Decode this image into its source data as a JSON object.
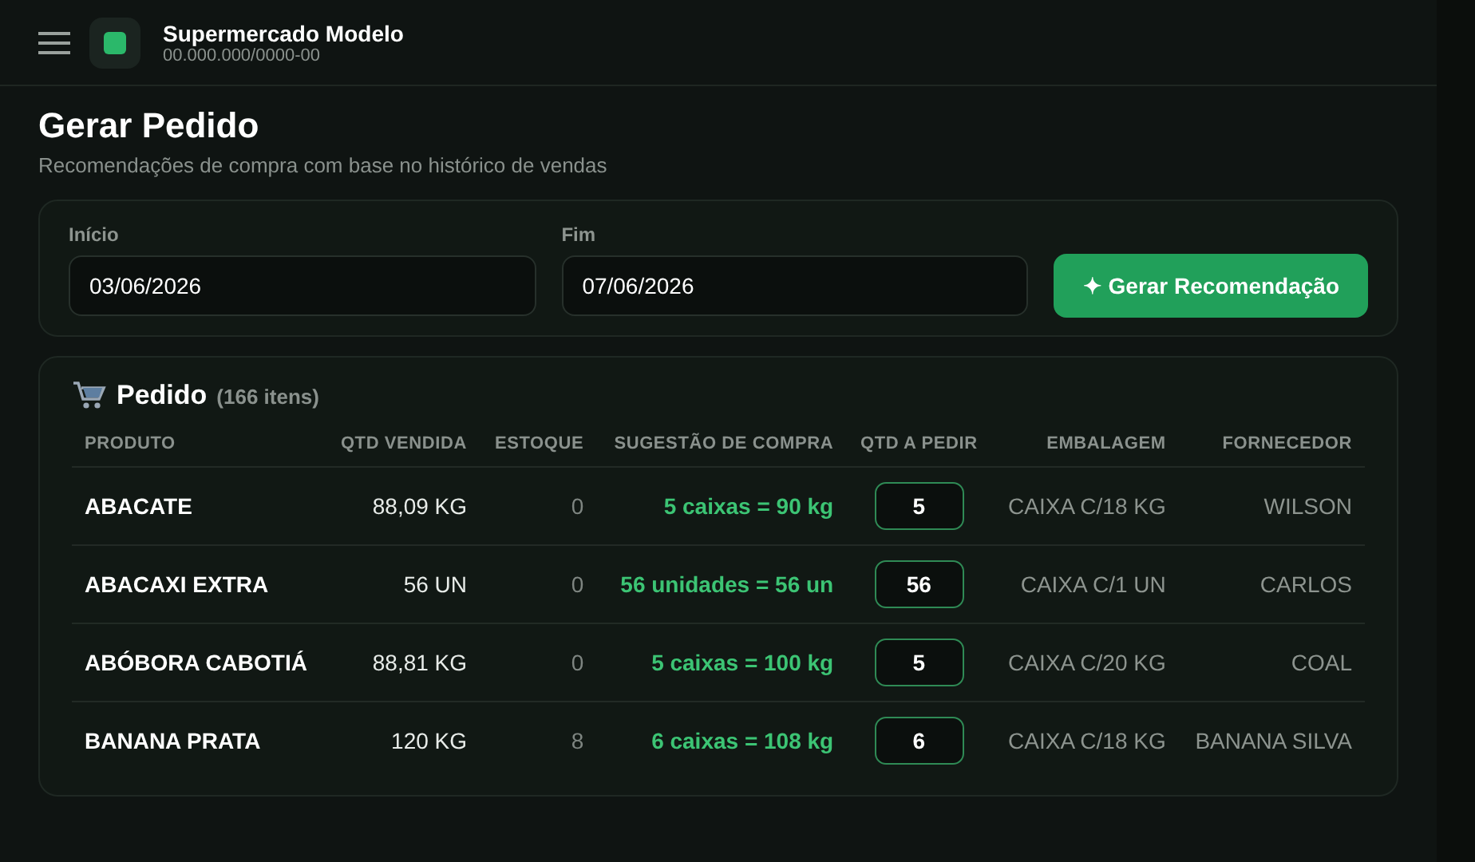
{
  "header": {
    "company": "Supermercado Modelo",
    "document": "00.000.000/0000-00"
  },
  "page": {
    "title": "Gerar Pedido",
    "subtitle": "Recomendações de compra com base no histórico de vendas"
  },
  "filters": {
    "fields": [
      {
        "label": "Início",
        "value": "03/06/2026"
      },
      {
        "label": "Fim",
        "value": "07/06/2026"
      }
    ],
    "button": "✦ Gerar Recomendação"
  },
  "order": {
    "title": "Pedido",
    "count": "(166 itens)",
    "columns": [
      "PRODUTO",
      "QTD VENDIDA",
      "ESTOQUE",
      "SUGESTÃO DE COMPRA",
      "QTD A PEDIR",
      "EMBALAGEM",
      "FORNECEDOR"
    ],
    "rows": [
      {
        "product": "ABACATE",
        "sold": "88,09 KG",
        "stock": "0",
        "suggestion": "5 caixas = 90 kg",
        "quantity": "5",
        "packaging": "CAIXA C/18 KG",
        "supplier": "WILSON"
      },
      {
        "product": "ABACAXI EXTRA",
        "sold": "56 UN",
        "stock": "0",
        "suggestion": "56 unidades = 56 un",
        "quantity": "56",
        "packaging": "CAIXA C/1 UN",
        "supplier": "CARLOS"
      },
      {
        "product": "ABÓBORA CABOTIÁ",
        "sold": "88,81 KG",
        "stock": "0",
        "suggestion": "5 caixas = 100 kg",
        "quantity": "5",
        "packaging": "CAIXA C/20 KG",
        "supplier": "COAL"
      },
      {
        "product": "BANANA PRATA",
        "sold": "120 KG",
        "stock": "8",
        "suggestion": "6 caixas = 108 kg",
        "quantity": "6",
        "packaging": "CAIXA C/18 KG",
        "supplier": "BANANA SILVA"
      }
    ]
  }
}
